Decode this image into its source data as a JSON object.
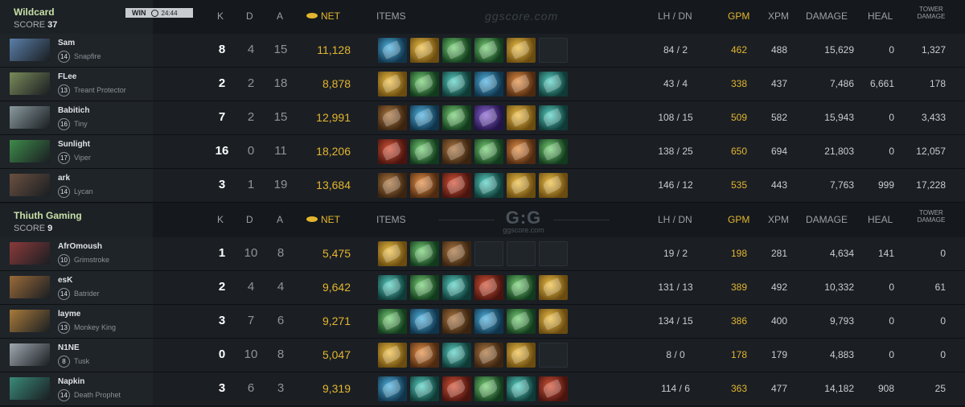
{
  "watermark_top": "ggscore.com",
  "watermark_mid": {
    "logo": "G:G",
    "site": "ggscore.com"
  },
  "headers": {
    "k": "K",
    "d": "D",
    "a": "A",
    "net": "NET",
    "items": "ITEMS",
    "lh_dn": "LH  /  DN",
    "gpm": "GPM",
    "xpm": "XPM",
    "damage": "DAMAGE",
    "heal": "HEAL",
    "tower_damage": "TOWER DAMAGE"
  },
  "colors": {
    "gold": "#e3b52e",
    "team_name": "#c7e0a6"
  },
  "teams": [
    {
      "name": "Wildcard",
      "score_label": "SCORE",
      "score": "37",
      "result": "WIN",
      "duration": "24:44",
      "players": [
        {
          "name": "Sam",
          "level": "14",
          "hero": "Snapfire",
          "portrait": "#5a7fa8",
          "k": "8",
          "d": "4",
          "a": "15",
          "net": "11,128",
          "lh_dn": "84  /  2",
          "gpm": "462",
          "xpm": "488",
          "damage": "15,629",
          "heal": "0",
          "tower": "1,327",
          "items": [
            "blue",
            "gold",
            "green",
            "green",
            "gold",
            "empty"
          ]
        },
        {
          "name": "FLee",
          "level": "13",
          "hero": "Treant Protector",
          "portrait": "#7a8a5a",
          "k": "2",
          "d": "2",
          "a": "18",
          "net": "8,878",
          "lh_dn": "43  /  4",
          "gpm": "338",
          "xpm": "437",
          "damage": "7,486",
          "heal": "6,661",
          "tower": "178",
          "items": [
            "gold",
            "green",
            "teal",
            "blue",
            "orange",
            "teal"
          ]
        },
        {
          "name": "Babitich",
          "level": "16",
          "hero": "Tiny",
          "portrait": "#8a9a9e",
          "k": "7",
          "d": "2",
          "a": "15",
          "net": "12,991",
          "lh_dn": "108  /  15",
          "gpm": "509",
          "xpm": "582",
          "damage": "15,943",
          "heal": "0",
          "tower": "3,433",
          "items": [
            "brown",
            "blue",
            "green",
            "purple",
            "gold",
            "teal"
          ]
        },
        {
          "name": "Sunlight",
          "level": "17",
          "hero": "Viper",
          "portrait": "#3e8a4a",
          "k": "16",
          "d": "0",
          "a": "11",
          "net": "18,206",
          "lh_dn": "138  /  25",
          "gpm": "650",
          "xpm": "694",
          "damage": "21,803",
          "heal": "0",
          "tower": "12,057",
          "items": [
            "red",
            "green",
            "brown",
            "green",
            "orange",
            "green"
          ]
        },
        {
          "name": "ark",
          "level": "14",
          "hero": "Lycan",
          "portrait": "#6a5040",
          "k": "3",
          "d": "1",
          "a": "19",
          "net": "13,684",
          "lh_dn": "146  /  12",
          "gpm": "535",
          "xpm": "443",
          "damage": "7,763",
          "heal": "999",
          "tower": "17,228",
          "items": [
            "brown",
            "orange",
            "red",
            "teal",
            "gold",
            "gold"
          ]
        }
      ]
    },
    {
      "name": "Thiuth Gaming",
      "score_label": "SCORE",
      "score": "9",
      "players": [
        {
          "name": "AfrOmoush",
          "level": "10",
          "hero": "Grimstroke",
          "portrait": "#8a3a3a",
          "k": "1",
          "d": "10",
          "a": "8",
          "net": "5,475",
          "lh_dn": "19  /  2",
          "gpm": "198",
          "xpm": "281",
          "damage": "4,634",
          "heal": "141",
          "tower": "0",
          "items": [
            "gold",
            "green",
            "brown",
            "empty",
            "empty",
            "empty"
          ]
        },
        {
          "name": "esK",
          "level": "14",
          "hero": "Batrider",
          "portrait": "#9a6a3a",
          "k": "2",
          "d": "4",
          "a": "4",
          "net": "9,642",
          "lh_dn": "131  /  13",
          "gpm": "389",
          "xpm": "492",
          "damage": "10,332",
          "heal": "0",
          "tower": "61",
          "items": [
            "teal",
            "green",
            "teal",
            "red",
            "green",
            "gold"
          ]
        },
        {
          "name": "layme",
          "level": "13",
          "hero": "Monkey King",
          "portrait": "#a87a3a",
          "k": "3",
          "d": "7",
          "a": "6",
          "net": "9,271",
          "lh_dn": "134  /  15",
          "gpm": "386",
          "xpm": "400",
          "damage": "9,793",
          "heal": "0",
          "tower": "0",
          "items": [
            "green",
            "blue",
            "brown",
            "blue",
            "green",
            "gold"
          ]
        },
        {
          "name": "N1NE",
          "level": "8",
          "hero": "Tusk",
          "portrait": "#a0a8b0",
          "k": "0",
          "d": "10",
          "a": "8",
          "net": "5,047",
          "lh_dn": "8  /  0",
          "gpm": "178",
          "xpm": "179",
          "damage": "4,883",
          "heal": "0",
          "tower": "0",
          "items": [
            "gold",
            "orange",
            "teal",
            "brown",
            "gold",
            "empty"
          ]
        },
        {
          "name": "Napkin",
          "level": "14",
          "hero": "Death Prophet",
          "portrait": "#3a8a7a",
          "k": "3",
          "d": "6",
          "a": "3",
          "net": "9,319",
          "lh_dn": "114  /  6",
          "gpm": "363",
          "xpm": "477",
          "damage": "14,182",
          "heal": "908",
          "tower": "25",
          "items": [
            "blue",
            "teal",
            "red",
            "green",
            "teal",
            "red"
          ]
        }
      ]
    }
  ]
}
